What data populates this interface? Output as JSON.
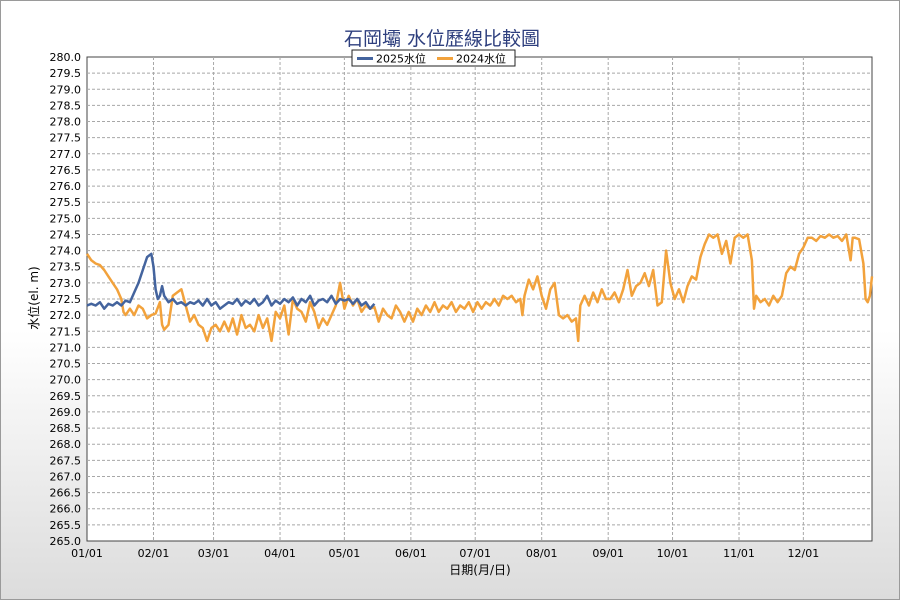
{
  "chart_data": {
    "type": "line",
    "title": "石岡壩 水位歷線比較圖",
    "xlabel": "日期(月/日)",
    "ylabel": "水位(el. m)",
    "ylim": [
      265.0,
      280.0
    ],
    "y_tick_step": 0.5,
    "x_ticks": [
      "01/01",
      "02/01",
      "03/01",
      "04/01",
      "05/01",
      "06/01",
      "07/01",
      "08/01",
      "09/01",
      "10/01",
      "11/01",
      "12/01"
    ],
    "x_tick_days": [
      0,
      31,
      59,
      90,
      120,
      151,
      181,
      212,
      243,
      273,
      304,
      334
    ],
    "x_range_days": [
      0,
      366
    ],
    "grid": true,
    "legend_position": "top-center",
    "series": [
      {
        "name": "2025水位",
        "color": "#44649e",
        "points": [
          [
            0,
            272.3
          ],
          [
            2,
            272.35
          ],
          [
            4,
            272.3
          ],
          [
            6,
            272.4
          ],
          [
            8,
            272.2
          ],
          [
            10,
            272.35
          ],
          [
            12,
            272.3
          ],
          [
            14,
            272.4
          ],
          [
            16,
            272.3
          ],
          [
            18,
            272.45
          ],
          [
            20,
            272.4
          ],
          [
            22,
            272.7
          ],
          [
            24,
            273.0
          ],
          [
            26,
            273.4
          ],
          [
            28,
            273.8
          ],
          [
            30,
            273.9
          ],
          [
            31,
            273.5
          ],
          [
            32,
            272.8
          ],
          [
            33,
            272.5
          ],
          [
            34,
            272.6
          ],
          [
            35,
            272.9
          ],
          [
            36,
            272.6
          ],
          [
            38,
            272.4
          ],
          [
            40,
            272.5
          ],
          [
            42,
            272.35
          ],
          [
            44,
            272.4
          ],
          [
            46,
            272.3
          ],
          [
            48,
            272.4
          ],
          [
            50,
            272.35
          ],
          [
            52,
            272.45
          ],
          [
            54,
            272.3
          ],
          [
            56,
            272.5
          ],
          [
            58,
            272.3
          ],
          [
            60,
            272.4
          ],
          [
            62,
            272.2
          ],
          [
            64,
            272.3
          ],
          [
            66,
            272.4
          ],
          [
            68,
            272.35
          ],
          [
            70,
            272.5
          ],
          [
            72,
            272.3
          ],
          [
            74,
            272.45
          ],
          [
            76,
            272.35
          ],
          [
            78,
            272.5
          ],
          [
            80,
            272.3
          ],
          [
            82,
            272.4
          ],
          [
            84,
            272.6
          ],
          [
            86,
            272.3
          ],
          [
            88,
            272.45
          ],
          [
            90,
            272.35
          ],
          [
            92,
            272.5
          ],
          [
            94,
            272.4
          ],
          [
            96,
            272.55
          ],
          [
            98,
            272.3
          ],
          [
            100,
            272.5
          ],
          [
            102,
            272.4
          ],
          [
            104,
            272.6
          ],
          [
            106,
            272.3
          ],
          [
            108,
            272.45
          ],
          [
            110,
            272.5
          ],
          [
            112,
            272.4
          ],
          [
            114,
            272.6
          ],
          [
            116,
            272.35
          ],
          [
            118,
            272.5
          ],
          [
            120,
            272.45
          ],
          [
            122,
            272.5
          ],
          [
            124,
            272.35
          ],
          [
            126,
            272.5
          ],
          [
            128,
            272.3
          ],
          [
            130,
            272.4
          ],
          [
            132,
            272.2
          ],
          [
            134,
            272.35
          ]
        ]
      },
      {
        "name": "2024水位",
        "color": "#f2a23c",
        "points": [
          [
            0,
            273.9
          ],
          [
            2,
            273.7
          ],
          [
            4,
            273.6
          ],
          [
            6,
            273.55
          ],
          [
            8,
            273.4
          ],
          [
            10,
            273.2
          ],
          [
            12,
            273.0
          ],
          [
            14,
            272.8
          ],
          [
            16,
            272.5
          ],
          [
            17,
            272.1
          ],
          [
            18,
            272.0
          ],
          [
            20,
            272.2
          ],
          [
            22,
            272.0
          ],
          [
            24,
            272.3
          ],
          [
            26,
            272.2
          ],
          [
            28,
            271.9
          ],
          [
            30,
            272.0
          ],
          [
            32,
            272.05
          ],
          [
            34,
            272.4
          ],
          [
            35,
            271.7
          ],
          [
            36,
            271.55
          ],
          [
            38,
            271.7
          ],
          [
            40,
            272.6
          ],
          [
            42,
            272.7
          ],
          [
            44,
            272.8
          ],
          [
            46,
            272.3
          ],
          [
            48,
            271.8
          ],
          [
            50,
            272.0
          ],
          [
            52,
            271.7
          ],
          [
            54,
            271.6
          ],
          [
            56,
            271.2
          ],
          [
            58,
            271.6
          ],
          [
            60,
            271.7
          ],
          [
            62,
            271.5
          ],
          [
            64,
            271.8
          ],
          [
            66,
            271.5
          ],
          [
            68,
            271.9
          ],
          [
            70,
            271.4
          ],
          [
            72,
            272.0
          ],
          [
            74,
            271.6
          ],
          [
            76,
            271.7
          ],
          [
            78,
            271.5
          ],
          [
            80,
            272.0
          ],
          [
            82,
            271.6
          ],
          [
            84,
            271.9
          ],
          [
            86,
            271.2
          ],
          [
            88,
            272.1
          ],
          [
            90,
            271.9
          ],
          [
            92,
            272.3
          ],
          [
            94,
            271.4
          ],
          [
            96,
            272.5
          ],
          [
            98,
            272.2
          ],
          [
            100,
            272.1
          ],
          [
            102,
            271.8
          ],
          [
            104,
            272.4
          ],
          [
            106,
            272.1
          ],
          [
            108,
            271.6
          ],
          [
            110,
            271.9
          ],
          [
            112,
            271.7
          ],
          [
            114,
            272.0
          ],
          [
            116,
            272.3
          ],
          [
            118,
            273.0
          ],
          [
            120,
            272.2
          ],
          [
            122,
            272.6
          ],
          [
            124,
            272.3
          ],
          [
            126,
            272.5
          ],
          [
            128,
            272.1
          ],
          [
            130,
            272.3
          ],
          [
            132,
            272.2
          ],
          [
            134,
            272.25
          ],
          [
            136,
            271.8
          ],
          [
            138,
            272.2
          ],
          [
            140,
            272.0
          ],
          [
            142,
            271.9
          ],
          [
            144,
            272.3
          ],
          [
            146,
            272.1
          ],
          [
            148,
            271.8
          ],
          [
            150,
            272.1
          ],
          [
            152,
            271.8
          ],
          [
            154,
            272.2
          ],
          [
            156,
            272.0
          ],
          [
            158,
            272.3
          ],
          [
            160,
            272.1
          ],
          [
            162,
            272.4
          ],
          [
            164,
            272.1
          ],
          [
            166,
            272.3
          ],
          [
            168,
            272.2
          ],
          [
            170,
            272.4
          ],
          [
            172,
            272.1
          ],
          [
            174,
            272.3
          ],
          [
            176,
            272.2
          ],
          [
            178,
            272.4
          ],
          [
            180,
            272.1
          ],
          [
            182,
            272.4
          ],
          [
            184,
            272.2
          ],
          [
            186,
            272.4
          ],
          [
            188,
            272.3
          ],
          [
            190,
            272.5
          ],
          [
            192,
            272.3
          ],
          [
            194,
            272.6
          ],
          [
            196,
            272.5
          ],
          [
            198,
            272.6
          ],
          [
            200,
            272.4
          ],
          [
            202,
            272.5
          ],
          [
            203,
            272.0
          ],
          [
            204,
            272.6
          ],
          [
            206,
            273.1
          ],
          [
            208,
            272.8
          ],
          [
            210,
            273.2
          ],
          [
            212,
            272.6
          ],
          [
            214,
            272.2
          ],
          [
            216,
            272.8
          ],
          [
            218,
            273.0
          ],
          [
            220,
            272.0
          ],
          [
            222,
            271.9
          ],
          [
            224,
            272.0
          ],
          [
            226,
            271.8
          ],
          [
            228,
            271.9
          ],
          [
            229,
            271.2
          ],
          [
            230,
            272.3
          ],
          [
            232,
            272.6
          ],
          [
            234,
            272.3
          ],
          [
            236,
            272.7
          ],
          [
            238,
            272.4
          ],
          [
            240,
            272.8
          ],
          [
            242,
            272.5
          ],
          [
            244,
            272.5
          ],
          [
            246,
            272.7
          ],
          [
            248,
            272.4
          ],
          [
            250,
            272.8
          ],
          [
            252,
            273.4
          ],
          [
            254,
            272.6
          ],
          [
            256,
            272.9
          ],
          [
            258,
            273.0
          ],
          [
            260,
            273.3
          ],
          [
            262,
            272.9
          ],
          [
            264,
            273.4
          ],
          [
            266,
            272.3
          ],
          [
            268,
            272.4
          ],
          [
            270,
            274.0
          ],
          [
            272,
            273.0
          ],
          [
            274,
            272.5
          ],
          [
            276,
            272.8
          ],
          [
            278,
            272.4
          ],
          [
            280,
            272.9
          ],
          [
            282,
            273.2
          ],
          [
            284,
            273.1
          ],
          [
            286,
            273.8
          ],
          [
            288,
            274.2
          ],
          [
            290,
            274.5
          ],
          [
            292,
            274.4
          ],
          [
            294,
            274.5
          ],
          [
            296,
            273.9
          ],
          [
            298,
            274.3
          ],
          [
            300,
            273.6
          ],
          [
            302,
            274.4
          ],
          [
            304,
            274.5
          ],
          [
            306,
            274.4
          ],
          [
            308,
            274.5
          ],
          [
            310,
            273.7
          ],
          [
            311,
            272.2
          ],
          [
            312,
            272.6
          ],
          [
            314,
            272.4
          ],
          [
            316,
            272.5
          ],
          [
            318,
            272.3
          ],
          [
            320,
            272.6
          ],
          [
            322,
            272.4
          ],
          [
            324,
            272.6
          ],
          [
            326,
            273.3
          ],
          [
            328,
            273.5
          ],
          [
            330,
            273.4
          ],
          [
            332,
            273.9
          ],
          [
            334,
            274.1
          ],
          [
            336,
            274.4
          ],
          [
            338,
            274.4
          ],
          [
            340,
            274.3
          ],
          [
            342,
            274.45
          ],
          [
            344,
            274.4
          ],
          [
            346,
            274.5
          ],
          [
            348,
            274.4
          ],
          [
            350,
            274.45
          ],
          [
            352,
            274.3
          ],
          [
            354,
            274.5
          ],
          [
            356,
            273.7
          ],
          [
            357,
            274.4
          ],
          [
            358,
            274.4
          ],
          [
            360,
            274.35
          ],
          [
            362,
            273.6
          ],
          [
            363,
            272.5
          ],
          [
            364,
            272.4
          ],
          [
            365,
            272.6
          ],
          [
            366,
            273.2
          ]
        ]
      }
    ]
  }
}
